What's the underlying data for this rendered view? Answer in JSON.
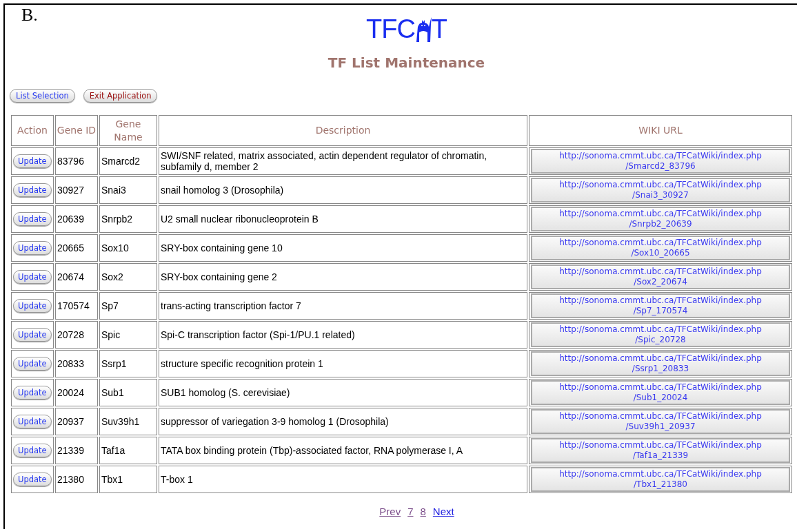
{
  "figure_label": "B.",
  "logo": {
    "before": "TFC",
    "after": "T"
  },
  "title": "TF List Maintenance",
  "buttons": [
    {
      "label": "List Selection",
      "kind": "nav"
    },
    {
      "label": "Exit Application",
      "kind": "exit"
    }
  ],
  "table": {
    "columns": [
      "Action",
      "Gene ID",
      "Gene Name",
      "Description",
      "WIKI URL"
    ],
    "rows": [
      {
        "action": "Update",
        "gene_id": "83796",
        "gene_name": "Smarcd2",
        "description": "SWI/SNF related, matrix associated, actin dependent regulator of chromatin, subfamily d, member 2",
        "wiki_url": [
          "http://sonoma.cmmt.ubc.ca/TFCatWiki/index.php",
          "/Smarcd2_83796"
        ]
      },
      {
        "action": "Update",
        "gene_id": "30927",
        "gene_name": "Snai3",
        "description": "snail homolog 3 (Drosophila)",
        "wiki_url": [
          "http://sonoma.cmmt.ubc.ca/TFCatWiki/index.php",
          "/Snai3_30927"
        ]
      },
      {
        "action": "Update",
        "gene_id": "20639",
        "gene_name": "Snrpb2",
        "description": "U2 small nuclear ribonucleoprotein B",
        "wiki_url": [
          "http://sonoma.cmmt.ubc.ca/TFCatWiki/index.php",
          "/Snrpb2_20639"
        ]
      },
      {
        "action": "Update",
        "gene_id": "20665",
        "gene_name": "Sox10",
        "description": "SRY-box containing gene 10",
        "wiki_url": [
          "http://sonoma.cmmt.ubc.ca/TFCatWiki/index.php",
          "/Sox10_20665"
        ]
      },
      {
        "action": "Update",
        "gene_id": "20674",
        "gene_name": "Sox2",
        "description": "SRY-box containing gene 2",
        "wiki_url": [
          "http://sonoma.cmmt.ubc.ca/TFCatWiki/index.php",
          "/Sox2_20674"
        ]
      },
      {
        "action": "Update",
        "gene_id": "170574",
        "gene_name": "Sp7",
        "description": "trans-acting transcription factor 7",
        "wiki_url": [
          "http://sonoma.cmmt.ubc.ca/TFCatWiki/index.php",
          "/Sp7_170574"
        ]
      },
      {
        "action": "Update",
        "gene_id": "20728",
        "gene_name": "Spic",
        "description": "Spi-C transcription factor (Spi-1/PU.1 related)",
        "wiki_url": [
          "http://sonoma.cmmt.ubc.ca/TFCatWiki/index.php",
          "/Spic_20728"
        ]
      },
      {
        "action": "Update",
        "gene_id": "20833",
        "gene_name": "Ssrp1",
        "description": "structure specific recognition protein 1",
        "wiki_url": [
          "http://sonoma.cmmt.ubc.ca/TFCatWiki/index.php",
          "/Ssrp1_20833"
        ]
      },
      {
        "action": "Update",
        "gene_id": "20024",
        "gene_name": "Sub1",
        "description": "SUB1 homolog (S. cerevisiae)",
        "wiki_url": [
          "http://sonoma.cmmt.ubc.ca/TFCatWiki/index.php",
          "/Sub1_20024"
        ]
      },
      {
        "action": "Update",
        "gene_id": "20937",
        "gene_name": "Suv39h1",
        "description": "suppressor of variegation 3-9 homolog 1 (Drosophila)",
        "wiki_url": [
          "http://sonoma.cmmt.ubc.ca/TFCatWiki/index.php",
          "/Suv39h1_20937"
        ]
      },
      {
        "action": "Update",
        "gene_id": "21339",
        "gene_name": "Taf1a",
        "description": "TATA box binding protein (Tbp)-associated factor, RNA polymerase I, A",
        "wiki_url": [
          "http://sonoma.cmmt.ubc.ca/TFCatWiki/index.php",
          "/Taf1a_21339"
        ]
      },
      {
        "action": "Update",
        "gene_id": "21380",
        "gene_name": "Tbx1",
        "description": "T-box 1",
        "wiki_url": [
          "http://sonoma.cmmt.ubc.ca/TFCatWiki/index.php",
          "/Tbx1_21380"
        ]
      }
    ]
  },
  "pagination": [
    {
      "label": "Prev",
      "visited": true
    },
    {
      "label": "7",
      "visited": true
    },
    {
      "label": "8",
      "visited": true
    },
    {
      "label": "Next",
      "visited": false
    }
  ]
}
